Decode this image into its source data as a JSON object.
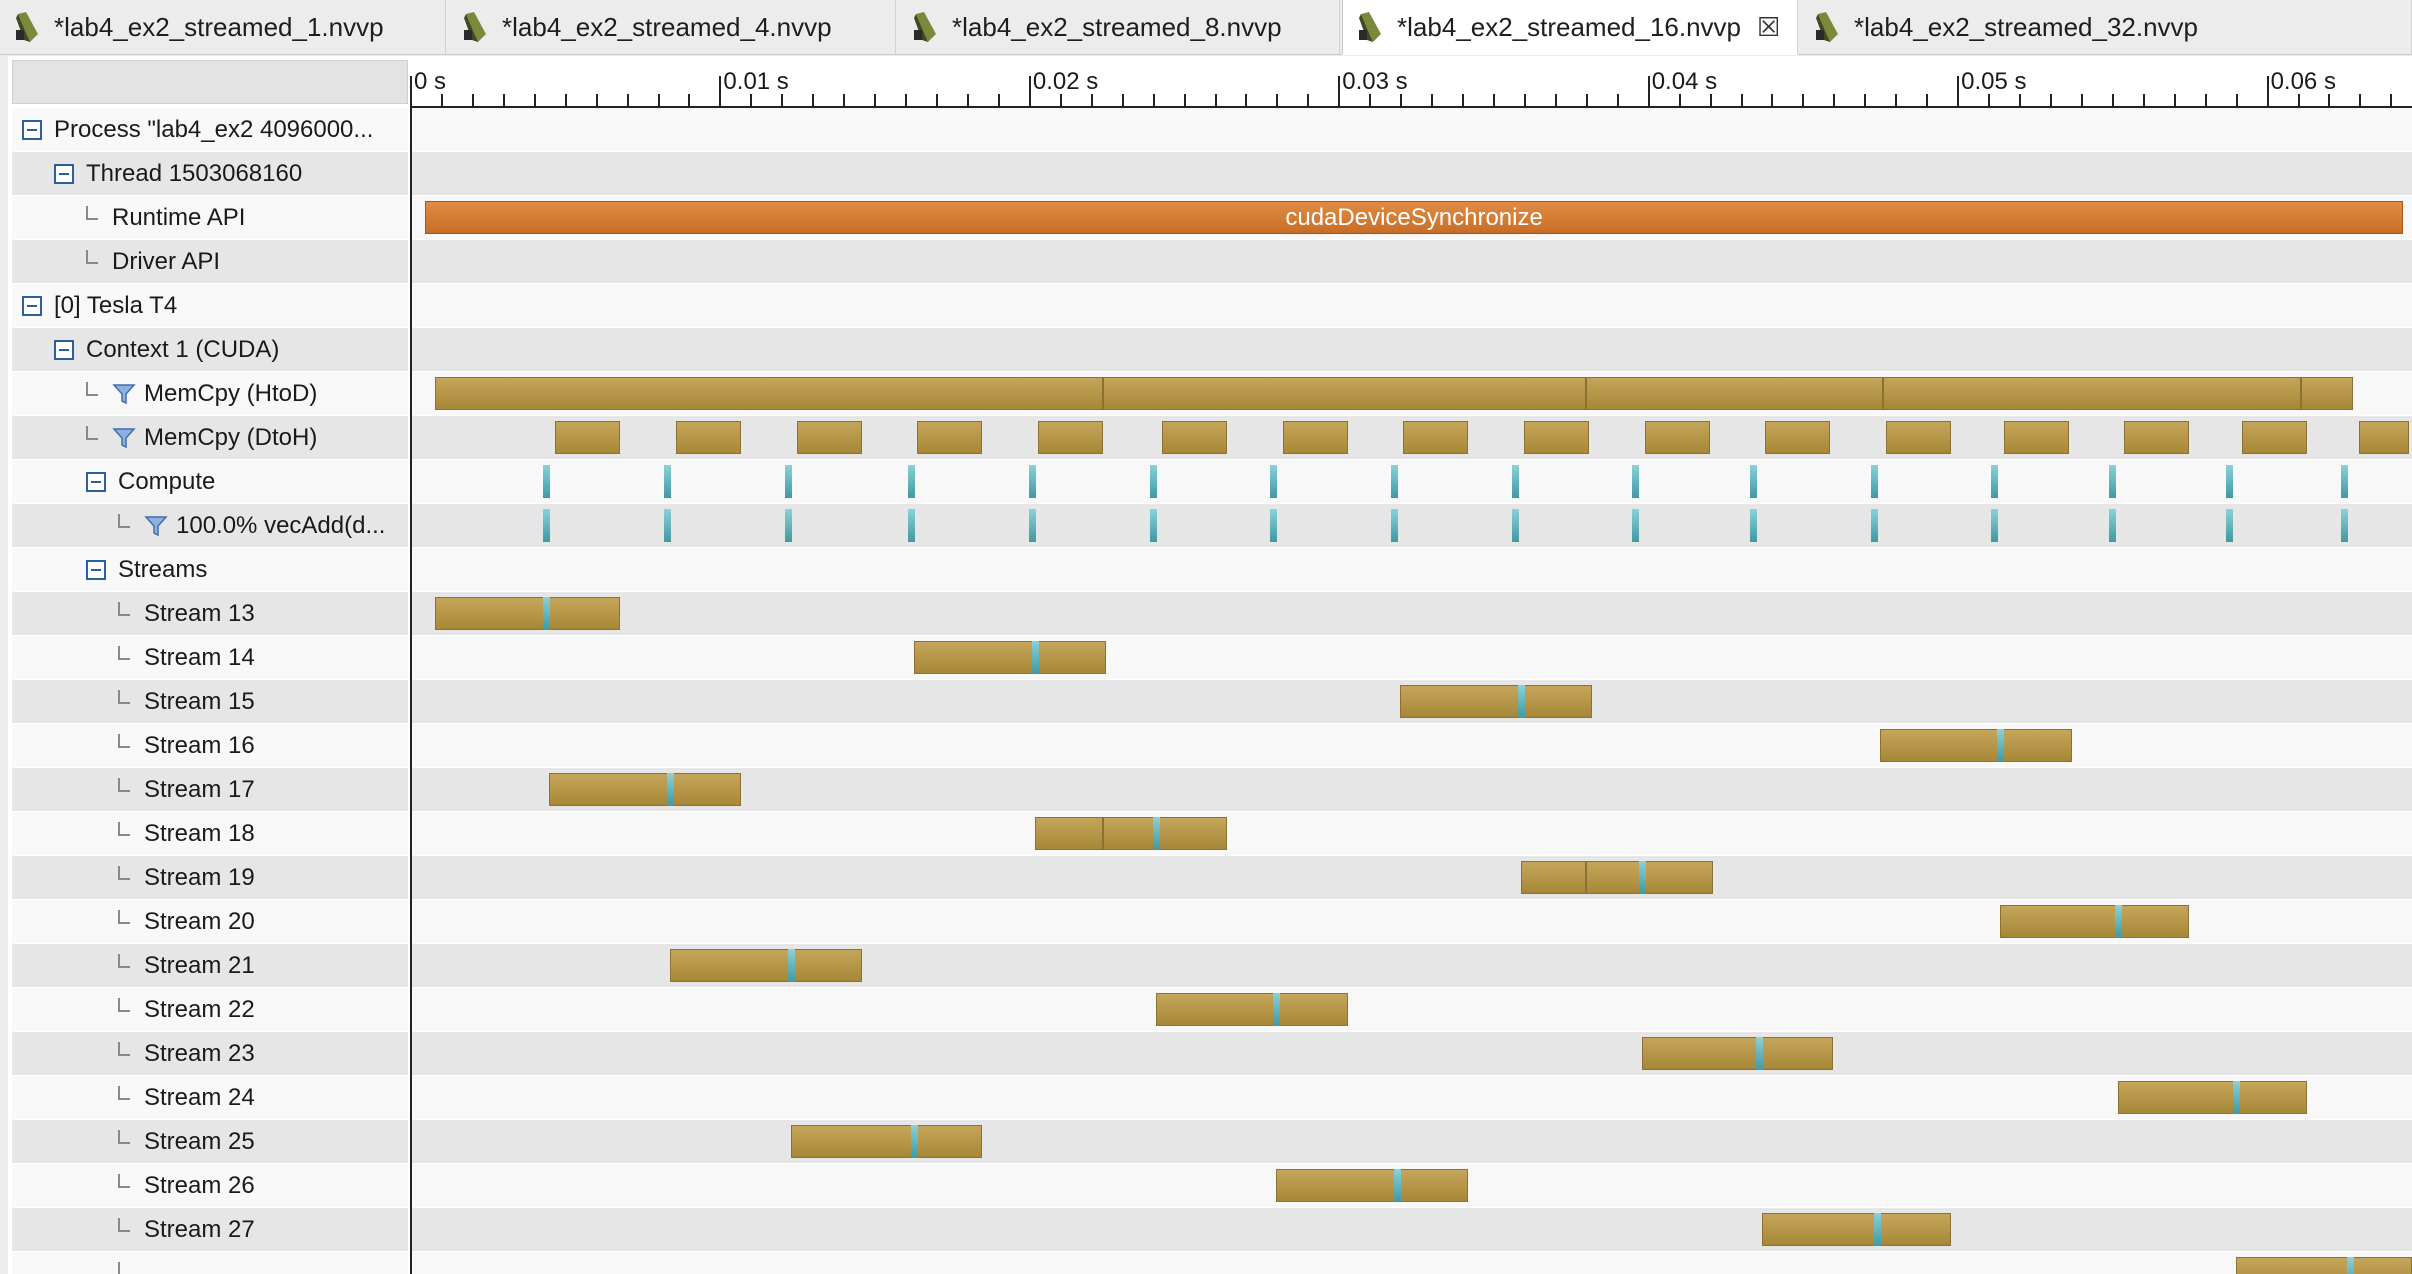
{
  "tabs": [
    {
      "label": "*lab4_ex2_streamed_1.nvvp",
      "active": false
    },
    {
      "label": "*lab4_ex2_streamed_4.nvvp",
      "active": false
    },
    {
      "label": "*lab4_ex2_streamed_8.nvvp",
      "active": false
    },
    {
      "label": "*lab4_ex2_streamed_16.nvvp",
      "active": true
    },
    {
      "label": "*lab4_ex2_streamed_32.nvvp",
      "active": false
    }
  ],
  "close_glyph": "☒",
  "ruler": {
    "ticks": [
      "0 s",
      "0.01 s",
      "0.02 s",
      "0.03 s",
      "0.04 s",
      "0.05 s",
      "0.06 s"
    ],
    "time_range_s": [
      0,
      0.0647
    ]
  },
  "rows": [
    {
      "label": "Process \"lab4_ex2 4096000...",
      "level": 0,
      "node": "collapse",
      "kind": "process"
    },
    {
      "label": "Thread 1503068160",
      "level": 1,
      "node": "collapse",
      "kind": "thread"
    },
    {
      "label": "Runtime API",
      "level": 2,
      "node": "leaf",
      "kind": "runtime-api",
      "api": [
        {
          "start": 0.0005,
          "end": 0.0644,
          "label": "cudaDeviceSynchronize"
        }
      ]
    },
    {
      "label": "Driver API",
      "level": 2,
      "node": "leaf",
      "kind": "driver-api"
    },
    {
      "label": "[0] Tesla T4",
      "level": 0,
      "node": "collapse",
      "kind": "device"
    },
    {
      "label": "Context 1 (CUDA)",
      "level": 1,
      "node": "collapse",
      "kind": "context"
    },
    {
      "label": "MemCpy (HtoD)",
      "level": 2,
      "node": "leaf",
      "filter": true,
      "kind": "memcpy-htod",
      "bars": [
        [
          0.0008,
          0.0224
        ],
        [
          0.0224,
          0.038
        ],
        [
          0.038,
          0.0476
        ],
        [
          0.0476,
          0.0611
        ],
        [
          0.0611,
          0.0628
        ]
      ]
    },
    {
      "label": "MemCpy (DtoH)",
      "level": 2,
      "node": "leaf",
      "filter": true,
      "kind": "memcpy-dtoh",
      "bars": [
        [
          0.0047,
          0.0068
        ],
        [
          0.0086,
          0.0107
        ],
        [
          0.0125,
          0.0146
        ],
        [
          0.0164,
          0.0185
        ],
        [
          0.0203,
          0.0224
        ],
        [
          0.0243,
          0.0264
        ],
        [
          0.0282,
          0.0303
        ],
        [
          0.0321,
          0.0342
        ],
        [
          0.036,
          0.0381
        ],
        [
          0.0399,
          0.042
        ],
        [
          0.0438,
          0.0459
        ],
        [
          0.0477,
          0.0498
        ],
        [
          0.0515,
          0.0536
        ],
        [
          0.0554,
          0.0575
        ],
        [
          0.0592,
          0.0613
        ],
        [
          0.063,
          0.0646
        ]
      ]
    },
    {
      "label": "Compute",
      "level": 2,
      "node": "collapse",
      "kind": "compute",
      "kernels": [
        0.0044,
        0.0083,
        0.0122,
        0.0162,
        0.0201,
        0.024,
        0.0279,
        0.0318,
        0.0357,
        0.0396,
        0.0434,
        0.0473,
        0.0512,
        0.055,
        0.0588,
        0.0625
      ]
    },
    {
      "label": "100.0% vecAdd(d...",
      "level": 3,
      "node": "leaf",
      "filter": true,
      "kind": "kernel",
      "kernels": [
        0.0044,
        0.0083,
        0.0122,
        0.0162,
        0.0201,
        0.024,
        0.0279,
        0.0318,
        0.0357,
        0.0396,
        0.0434,
        0.0473,
        0.0512,
        0.055,
        0.0588,
        0.0625
      ]
    },
    {
      "label": "Streams",
      "level": 2,
      "node": "collapse",
      "kind": "streams"
    },
    {
      "label": "Stream 13",
      "level": 3,
      "node": "leaf",
      "kind": "stream",
      "bars": [
        [
          0.0008,
          0.0068
        ]
      ],
      "kernels": [
        0.0044
      ]
    },
    {
      "label": "Stream 14",
      "level": 3,
      "node": "leaf",
      "kind": "stream",
      "bars": [
        [
          0.0163,
          0.0225
        ]
      ],
      "kernels": [
        0.0202
      ]
    },
    {
      "label": "Stream 15",
      "level": 3,
      "node": "leaf",
      "kind": "stream",
      "bars": [
        [
          0.032,
          0.0382
        ]
      ],
      "kernels": [
        0.0359
      ]
    },
    {
      "label": "Stream 16",
      "level": 3,
      "node": "leaf",
      "kind": "stream",
      "bars": [
        [
          0.0475,
          0.0537
        ]
      ],
      "kernels": [
        0.0514
      ]
    },
    {
      "label": "Stream 17",
      "level": 3,
      "node": "leaf",
      "kind": "stream",
      "bars": [
        [
          0.0045,
          0.0107
        ]
      ],
      "kernels": [
        0.0084
      ]
    },
    {
      "label": "Stream 18",
      "level": 3,
      "node": "leaf",
      "kind": "stream",
      "bars": [
        [
          0.0202,
          0.0224
        ],
        [
          0.0224,
          0.0264
        ]
      ],
      "kernels": [
        0.0241
      ]
    },
    {
      "label": "Stream 19",
      "level": 3,
      "node": "leaf",
      "kind": "stream",
      "bars": [
        [
          0.0359,
          0.038
        ],
        [
          0.038,
          0.0421
        ]
      ],
      "kernels": [
        0.0398
      ]
    },
    {
      "label": "Stream 20",
      "level": 3,
      "node": "leaf",
      "kind": "stream",
      "bars": [
        [
          0.0514,
          0.0575
        ]
      ],
      "kernels": [
        0.0552
      ]
    },
    {
      "label": "Stream 21",
      "level": 3,
      "node": "leaf",
      "kind": "stream",
      "bars": [
        [
          0.0084,
          0.0146
        ]
      ],
      "kernels": [
        0.0123
      ]
    },
    {
      "label": "Stream 22",
      "level": 3,
      "node": "leaf",
      "kind": "stream",
      "bars": [
        [
          0.0241,
          0.0303
        ]
      ],
      "kernels": [
        0.028
      ]
    },
    {
      "label": "Stream 23",
      "level": 3,
      "node": "leaf",
      "kind": "stream",
      "bars": [
        [
          0.0398,
          0.046
        ]
      ],
      "kernels": [
        0.0436
      ]
    },
    {
      "label": "Stream 24",
      "level": 3,
      "node": "leaf",
      "kind": "stream",
      "bars": [
        [
          0.0552,
          0.0613
        ]
      ],
      "kernels": [
        0.059
      ]
    },
    {
      "label": "Stream 25",
      "level": 3,
      "node": "leaf",
      "kind": "stream",
      "bars": [
        [
          0.0123,
          0.0185
        ]
      ],
      "kernels": [
        0.0163
      ]
    },
    {
      "label": "Stream 26",
      "level": 3,
      "node": "leaf",
      "kind": "stream",
      "bars": [
        [
          0.028,
          0.0342
        ]
      ],
      "kernels": [
        0.0319
      ]
    },
    {
      "label": "Stream 27",
      "level": 3,
      "node": "leaf",
      "kind": "stream",
      "bars": [
        [
          0.0437,
          0.0498
        ]
      ],
      "kernels": [
        0.0474
      ]
    },
    {
      "label": "",
      "level": 3,
      "node": "leaf",
      "kind": "stream",
      "bars": [
        [
          0.059,
          0.0647
        ]
      ],
      "kernels": [
        0.0627
      ]
    }
  ],
  "colors": {
    "memcpy": "#b3964a",
    "kernel": "#5fb4bd",
    "runtime_api": "#d4793a",
    "tree_node": "#2d5fa0"
  }
}
